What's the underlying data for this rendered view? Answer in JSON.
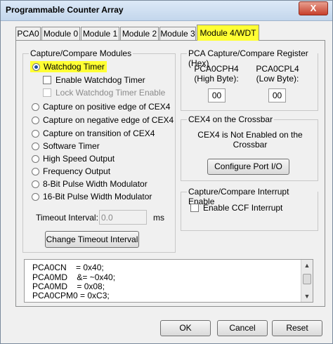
{
  "window": {
    "title": "Programmable Counter Array",
    "close_label": "X"
  },
  "tabs": [
    {
      "label": "PCA0"
    },
    {
      "label": "Module 0"
    },
    {
      "label": "Module 1"
    },
    {
      "label": "Module 2"
    },
    {
      "label": "Module 3"
    },
    {
      "label": "Module 4/WDT",
      "active": true
    }
  ],
  "capture_compare_modules": {
    "group_label": "Capture/Compare Modules",
    "modes": [
      {
        "label": "Watchdog Timer",
        "selected": true
      },
      {
        "label": "Capture on positive edge of CEX4"
      },
      {
        "label": "Capture on negative edge of CEX4"
      },
      {
        "label": "Capture on transition of CEX4"
      },
      {
        "label": "Software Timer"
      },
      {
        "label": "High Speed Output"
      },
      {
        "label": "Frequency Output"
      },
      {
        "label": "8-Bit Pulse Width Modulator"
      },
      {
        "label": "16-Bit Pulse Width Modulator"
      }
    ],
    "enable_watchdog_label": "Enable Watchdog Timer",
    "lock_watchdog_label": "Lock Watchdog Timer Enable",
    "timeout_label": "Timeout Interval:",
    "timeout_value": "0.0",
    "timeout_unit": "ms",
    "change_timeout_button": "Change Timeout Interval"
  },
  "register": {
    "group_label": "PCA Capture/Compare Register (Hex)",
    "high_label_1": "PCA0CPH4",
    "high_label_2": "(High Byte):",
    "high_value": "00",
    "low_label_1": "PCA0CPL4",
    "low_label_2": "(Low Byte):",
    "low_value": "00"
  },
  "crossbar": {
    "group_label": "CEX4 on the Crossbar",
    "status_line1": "CEX4 is Not Enabled on the",
    "status_line2": "Crossbar",
    "configure_button": "Configure Port I/O"
  },
  "interrupt": {
    "group_label": "Capture/Compare Interrupt Enable",
    "enable_ccf_label": "Enable CCF Interrupt"
  },
  "code_lines": [
    "PCA0CN    = 0x40;",
    "PCA0MD    &= ~0x40;",
    "PCA0MD    = 0x08;",
    "PCA0CPM0 = 0xC3;"
  ],
  "buttons": {
    "ok": "OK",
    "cancel": "Cancel",
    "reset": "Reset"
  },
  "colors": {
    "highlight": "#ffff33",
    "title_bar": "#c3d6ec",
    "close": "#c7402c"
  }
}
